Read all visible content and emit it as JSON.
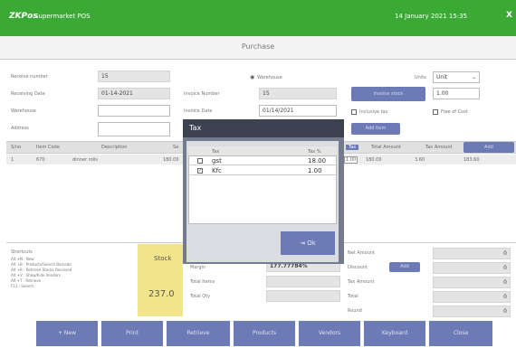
{
  "titlebar": {
    "logo": "ZKPos",
    "app_name": "Supermarket POS",
    "datetime": "14 January 2021 15:35",
    "close": "X"
  },
  "page_title": "Purchase",
  "form": {
    "receive_number_label": "Receive number",
    "receive_number": "15",
    "receiving_date_label": "Receiving Date",
    "receiving_date": "01-14-2021",
    "warehouse_label": "Warehouse",
    "address_label": "Address",
    "invoice_number_label": "Invoice Number",
    "invoice_number": "15",
    "invoice_date_label": "Invoice Date",
    "invoice_date": "01/14/2021",
    "warehouse_radio_label": "Warehouse",
    "units_label": "Units",
    "units_value": "Unit",
    "invoice_stock_btn": "invoice stock",
    "invoice_stock_value": "1.00",
    "inclusive_tax_label": "Inclusive tax",
    "free_of_cost_label": "Free of Cost",
    "add_item_btn": "Add Item"
  },
  "grid": {
    "headers": [
      "S/no",
      "Item Code",
      "Description",
      "Sa",
      "Tax",
      "Total Amount",
      "Tax Amount"
    ],
    "add_btn": "Add",
    "row": {
      "sno": "1",
      "code": "670",
      "desc": "dinner rolls",
      "price": "180.00",
      "qty": "1.00",
      "total": "180.00",
      "tax": "3.60",
      "amount": "183.60"
    }
  },
  "shortcuts": {
    "title": "Shortcuts",
    "lines": [
      "Alt +N : New",
      "Alt +B : Products/Search Barcode",
      "Alt +R : Retrieve Stocks Received",
      "Alt +V : Show/hide Vendors",
      "Alt +T : Retrieve",
      "F11 : Search"
    ]
  },
  "stock": {
    "label": "Stock",
    "value": "237.0"
  },
  "summary": {
    "margin_label": "Margin",
    "margin_value": "177.77784%",
    "total_items_label": "Total Items",
    "total_qty_label": "Total Qty"
  },
  "totals": {
    "net_amount_label": "Net Amount",
    "discount_label": "Discount",
    "discount_btn": "Add",
    "tax_amount_label": "Tax Amount",
    "total_label": "Total",
    "round_label": "Round",
    "values": [
      "0",
      "0",
      "0",
      "0",
      "0"
    ]
  },
  "toolbar": {
    "new": "+ New",
    "print": "Print",
    "retrieve": "Retrieve",
    "products": "Products",
    "vendors": "Vendors",
    "keyboard": "Keyboard",
    "close": "Close"
  },
  "tax_dialog": {
    "title": "Tax",
    "col_tax": "Tax",
    "col_pct": "Tax %",
    "rows": [
      {
        "checked": false,
        "name": "gst",
        "pct": "18.00"
      },
      {
        "checked": true,
        "name": "Kfc",
        "pct": "1.00"
      }
    ],
    "ok": "Ok"
  }
}
